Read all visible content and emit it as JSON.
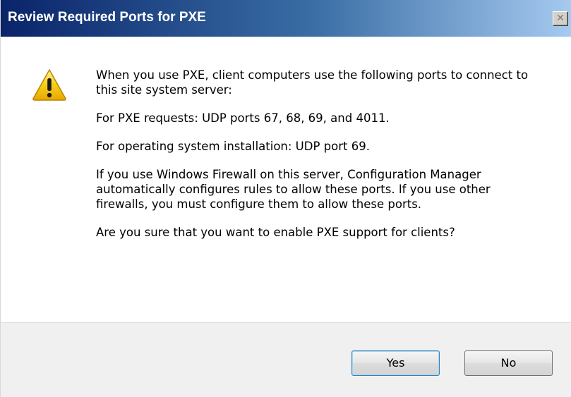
{
  "window": {
    "title": "Review Required Ports for PXE",
    "close_glyph": "✕"
  },
  "icons": {
    "warning": "warning-triangle-icon",
    "close": "close-icon"
  },
  "message": {
    "paragraphs": [
      "When you use PXE, client computers use the following ports to connect to this site system server:",
      "For PXE requests: UDP ports 67, 68, 69, and 4011.",
      "For operating system installation: UDP port 69.",
      "If you use Windows Firewall on this server, Configuration Manager automatically configures rules to allow these ports. If you use other firewalls, you must configure them to allow these ports.",
      "Are you sure that you want to enable PXE support for clients?"
    ]
  },
  "buttons": {
    "yes_label": "Yes",
    "no_label": "No"
  },
  "colors": {
    "title_bar_start": "#0a246a",
    "title_bar_end": "#a6caf0",
    "warning_fill": "#f5c400",
    "footer_background": "#f0f0f0"
  }
}
